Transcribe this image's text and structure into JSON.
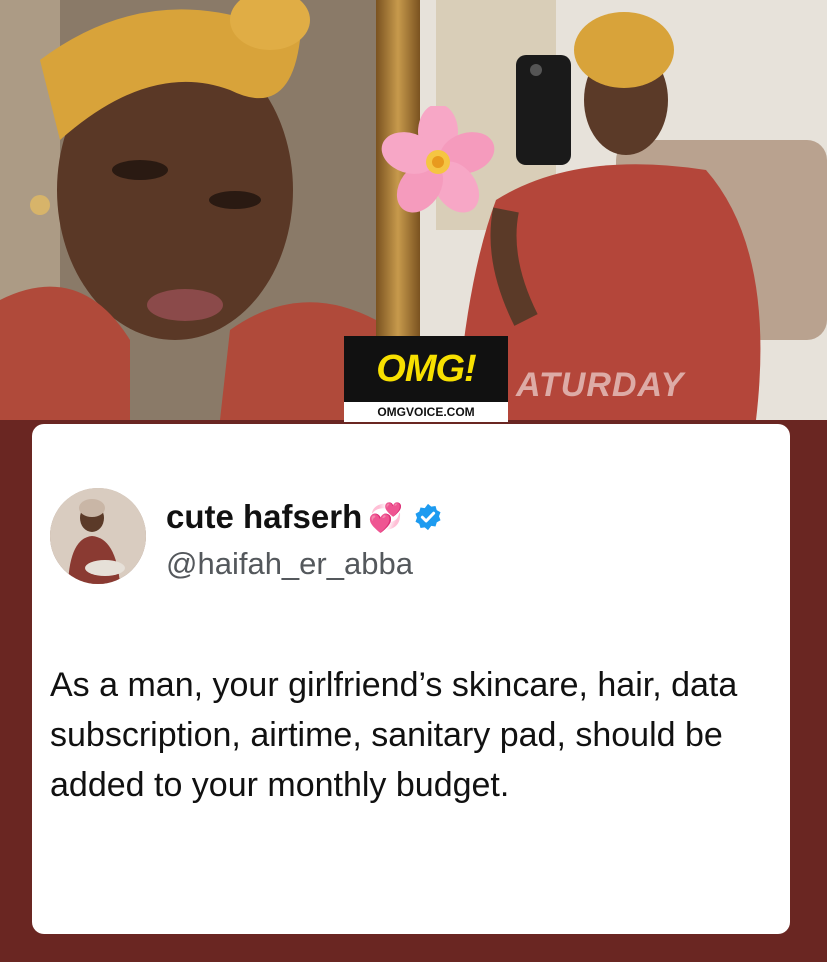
{
  "branding": {
    "logo_text": "OMG!",
    "site": "OMGVOICE.COM",
    "watermark": "ATURDAY"
  },
  "tweet": {
    "display_name": "cute hafserh",
    "name_emoji": "💞",
    "verified_icon": "verified-badge-icon",
    "handle": "@haifah_er_abba",
    "text": "As a man, your girlfriend’s skincare, hair, data subscription, airtime, sanitary pad, should be added to your monthly budget."
  },
  "colors": {
    "background": "#6a2622",
    "card": "#ffffff",
    "verified": "#1d9bf0",
    "omg_yellow": "#f7e000"
  }
}
